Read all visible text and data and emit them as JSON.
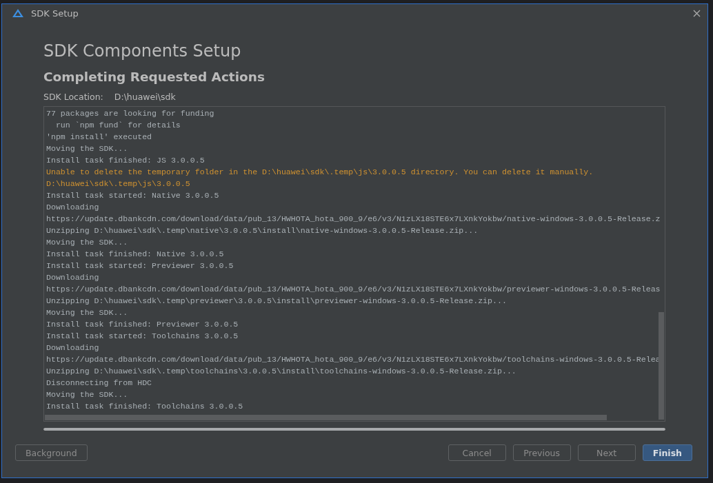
{
  "window": {
    "title": "SDK Setup"
  },
  "heading": "SDK Components Setup",
  "subheading": "Completing Requested Actions",
  "sdk_location": {
    "label": "SDK Location:",
    "value": "D:\\huawei\\sdk"
  },
  "log": [
    {
      "kind": "info",
      "text": "77 packages are looking for funding"
    },
    {
      "kind": "info",
      "text": "  run `npm fund` for details"
    },
    {
      "kind": "info",
      "text": "'npm install' executed"
    },
    {
      "kind": "info",
      "text": "Moving the SDK..."
    },
    {
      "kind": "info",
      "text": "Install task finished: JS 3.0.0.5"
    },
    {
      "kind": "warning",
      "text": "Unable to delete the temporary folder in the D:\\huawei\\sdk\\.temp\\js\\3.0.0.5 directory. You can delete it manually."
    },
    {
      "kind": "warning",
      "text": "D:\\huawei\\sdk\\.temp\\js\\3.0.0.5"
    },
    {
      "kind": "info",
      "text": "Install task started: Native 3.0.0.5"
    },
    {
      "kind": "info",
      "text": "Downloading"
    },
    {
      "kind": "info",
      "text": "https://update.dbankcdn.com/download/data/pub_13/HWHOTA_hota_900_9/e6/v3/N1zLX18STE6x7LXnkYokbw/native-windows-3.0.0.5-Release.z"
    },
    {
      "kind": "info",
      "text": "Unzipping D:\\huawei\\sdk\\.temp\\native\\3.0.0.5\\install\\native-windows-3.0.0.5-Release.zip..."
    },
    {
      "kind": "info",
      "text": "Moving the SDK..."
    },
    {
      "kind": "info",
      "text": "Install task finished: Native 3.0.0.5"
    },
    {
      "kind": "info",
      "text": "Install task started: Previewer 3.0.0.5"
    },
    {
      "kind": "info",
      "text": "Downloading"
    },
    {
      "kind": "info",
      "text": "https://update.dbankcdn.com/download/data/pub_13/HWHOTA_hota_900_9/e6/v3/N1zLX18STE6x7LXnkYokbw/previewer-windows-3.0.0.5-Releas"
    },
    {
      "kind": "info",
      "text": "Unzipping D:\\huawei\\sdk\\.temp\\previewer\\3.0.0.5\\install\\previewer-windows-3.0.0.5-Release.zip..."
    },
    {
      "kind": "info",
      "text": "Moving the SDK..."
    },
    {
      "kind": "info",
      "text": "Install task finished: Previewer 3.0.0.5"
    },
    {
      "kind": "info",
      "text": "Install task started: Toolchains 3.0.0.5"
    },
    {
      "kind": "info",
      "text": "Downloading"
    },
    {
      "kind": "info",
      "text": "https://update.dbankcdn.com/download/data/pub_13/HWHOTA_hota_900_9/e6/v3/N1zLX18STE6x7LXnkYokbw/toolchains-windows-3.0.0.5-Relea"
    },
    {
      "kind": "info",
      "text": "Unzipping D:\\huawei\\sdk\\.temp\\toolchains\\3.0.0.5\\install\\toolchains-windows-3.0.0.5-Release.zip..."
    },
    {
      "kind": "info",
      "text": "Disconnecting from HDC"
    },
    {
      "kind": "info",
      "text": "Moving the SDK..."
    },
    {
      "kind": "info",
      "text": "Install task finished: Toolchains 3.0.0.5"
    }
  ],
  "progress": {
    "level": 1
  },
  "footer": {
    "left_buttons": [
      {
        "label": "Background"
      }
    ],
    "right_buttons": [
      {
        "label": "Cancel",
        "kind": "default"
      },
      {
        "label": "Previous",
        "kind": "default"
      },
      {
        "label": "Next",
        "kind": "default"
      },
      {
        "label": "Finish",
        "kind": "primary"
      }
    ]
  }
}
